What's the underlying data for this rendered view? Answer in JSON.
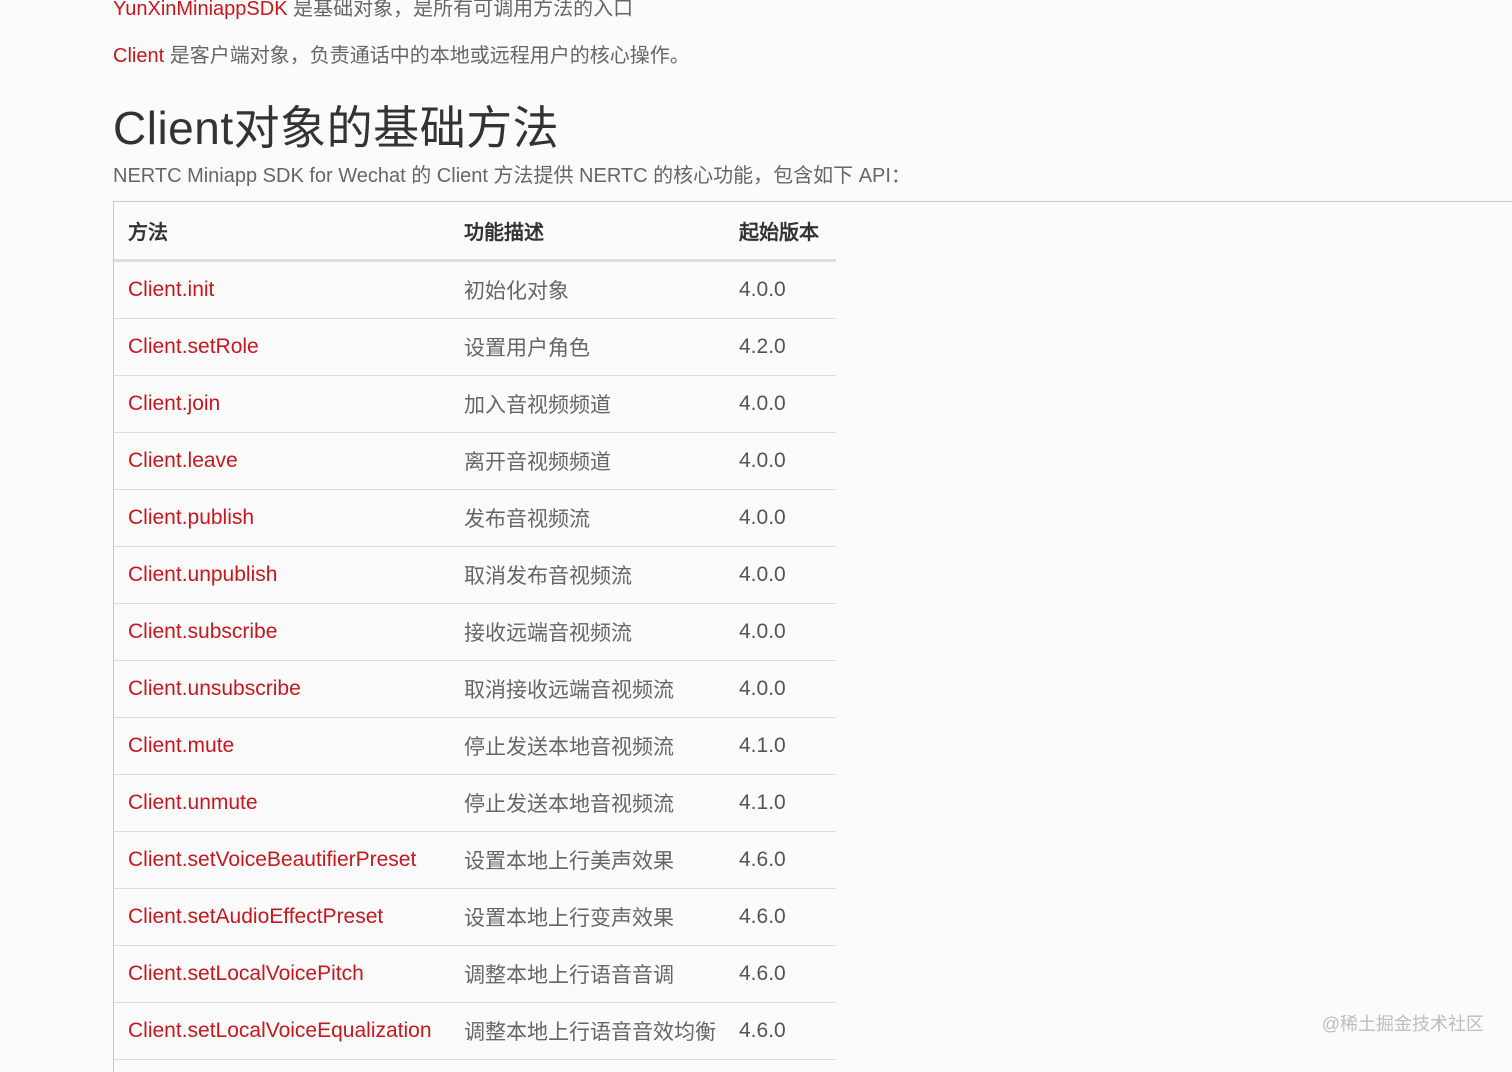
{
  "intro_lines": {
    "sdk_link": "YunXinMiniappSDK",
    "sdk_desc": " 是基础对象，是所有可调用方法的入口",
    "client_link": "Client",
    "client_desc": " 是客户端对象，负责通话中的本地或远程用户的核心操作。"
  },
  "section": {
    "title": "Client对象的基础方法",
    "description": "NERTC Miniapp SDK for Wechat 的 Client 方法提供 NERTC 的核心功能，包含如下 API："
  },
  "table": {
    "headers": [
      "方法",
      "功能描述",
      "起始版本"
    ],
    "rows": [
      {
        "method": "Client.init",
        "desc": "初始化对象",
        "version": "4.0.0"
      },
      {
        "method": "Client.setRole",
        "desc": "设置用户角色",
        "version": "4.2.0"
      },
      {
        "method": "Client.join",
        "desc": "加入音视频频道",
        "version": "4.0.0"
      },
      {
        "method": "Client.leave",
        "desc": "离开音视频频道",
        "version": "4.0.0"
      },
      {
        "method": "Client.publish",
        "desc": "发布音视频流",
        "version": "4.0.0"
      },
      {
        "method": "Client.unpublish",
        "desc": "取消发布音视频流",
        "version": "4.0.0"
      },
      {
        "method": "Client.subscribe",
        "desc": "接收远端音视频流",
        "version": "4.0.0"
      },
      {
        "method": "Client.unsubscribe",
        "desc": "取消接收远端音视频流",
        "version": "4.0.0"
      },
      {
        "method": "Client.mute",
        "desc": "停止发送本地音视频流",
        "version": "4.1.0"
      },
      {
        "method": "Client.unmute",
        "desc": "停止发送本地音视频流",
        "version": "4.1.0"
      },
      {
        "method": "Client.setVoiceBeautifierPreset",
        "desc": "设置本地上行美声效果",
        "version": "4.6.0"
      },
      {
        "method": "Client.setAudioEffectPreset",
        "desc": "设置本地上行变声效果",
        "version": "4.6.0"
      },
      {
        "method": "Client.setLocalVoicePitch",
        "desc": "调整本地上行语音音调",
        "version": "4.6.0"
      },
      {
        "method": "Client.setLocalVoiceEqualization",
        "desc": "调整本地上行语音音效均衡",
        "version": "4.6.0"
      }
    ]
  },
  "watermark": "@稀土掘金技术社区",
  "colors": {
    "link": "#c8161d",
    "text": "#666666",
    "heading": "#333333",
    "background": "#fbfbfb"
  }
}
